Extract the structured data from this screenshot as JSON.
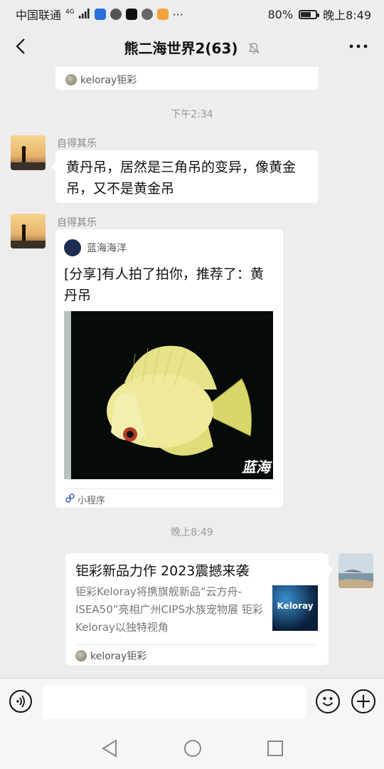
{
  "status_bar": {
    "carrier": "中国联通",
    "network": "4G",
    "battery": "80%",
    "battery_level": 0.8,
    "time": "晚上8:49",
    "more": "···"
  },
  "header": {
    "title": "熊二海世界2(63)",
    "muted_icon": "bell-off-icon",
    "more_icon": "more-dots-icon"
  },
  "top_partial_card": {
    "source": "keloray钜彩"
  },
  "messages": [
    {
      "timestamp": "下午2:34",
      "sender": "自得其乐",
      "text": "黄丹吊，居然是三角吊的变异，像黄金吊，又不是黄金吊"
    },
    {
      "sender": "自得其乐",
      "mini_program": {
        "account": "蓝海海洋",
        "title": "[分享]有人拍了拍你，推荐了：黄丹吊",
        "image_watermark": "蓝海",
        "footer": "小程序"
      }
    },
    {
      "timestamp": "晚上8:49",
      "link_card": {
        "title": "钜彩新品力作 2023震撼来袭",
        "description": "钜彩Keloray将携旗舰新品“云方舟-ISEA50”亮相广州CIPS水族宠物展 钜彩Keloray以独特视角",
        "thumbnail_text": "Keloray",
        "source": "keloray钜彩"
      }
    }
  ],
  "input": {
    "placeholder": ""
  },
  "colors": {
    "background": "#ededed",
    "bubble": "#ffffff",
    "text": "#111111"
  }
}
